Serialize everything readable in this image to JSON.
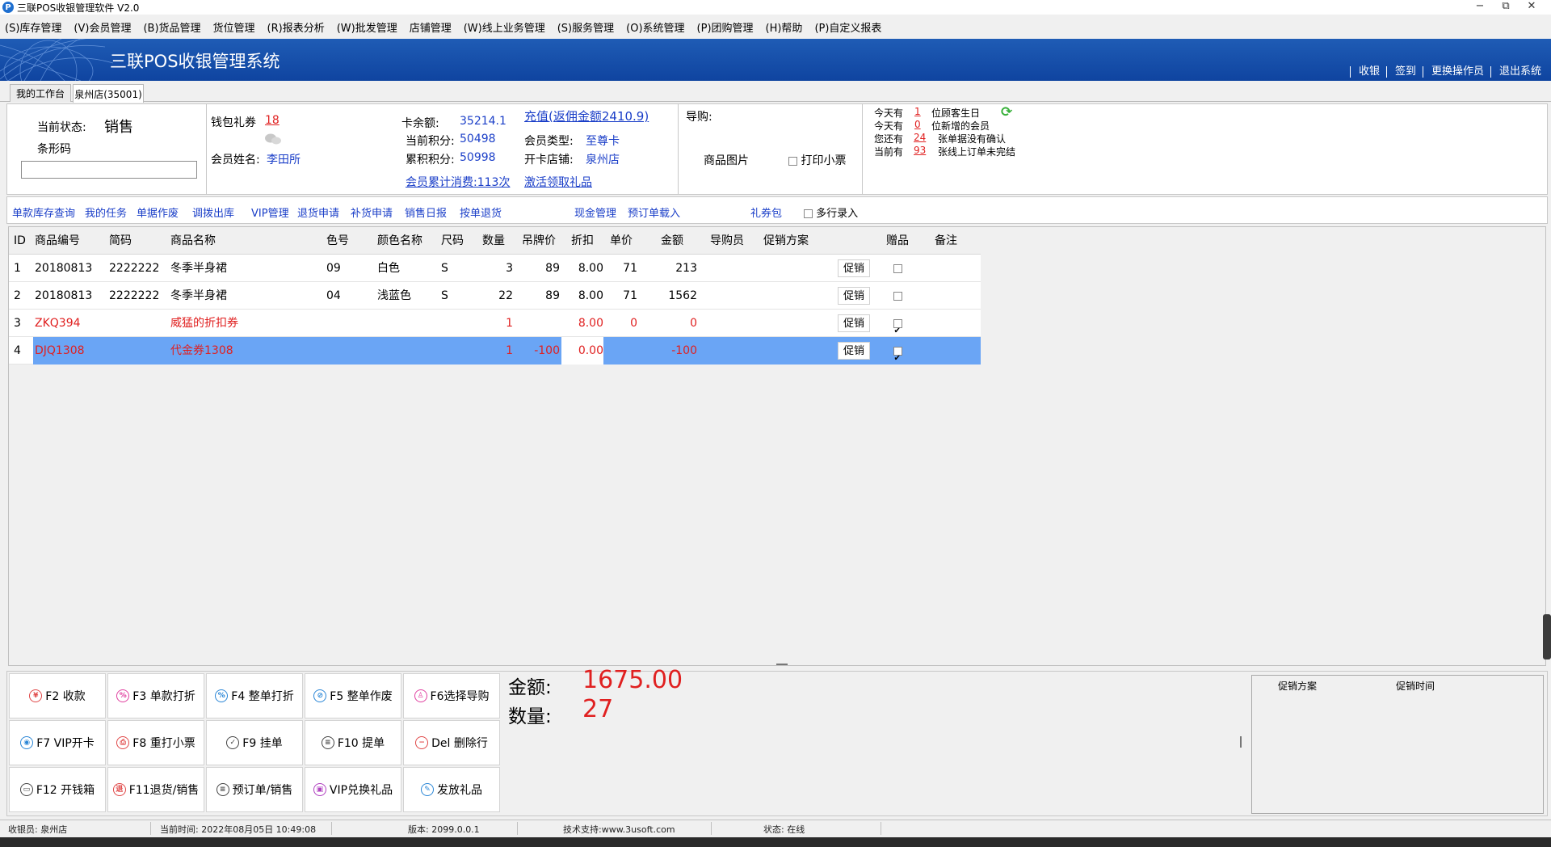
{
  "window": {
    "title": "三联POS收银管理软件 V2.0",
    "icon": "P",
    "minimize": "−",
    "restore": "⧉",
    "close": "✕"
  },
  "menu": [
    "(S)库存管理",
    "(V)会员管理",
    "(B)货品管理",
    "货位管理",
    "(R)报表分析",
    "(W)批发管理",
    "店铺管理",
    "(W)线上业务管理",
    "(S)服务管理",
    "(O)系统管理",
    "(P)团购管理",
    "(H)帮助",
    "(P)自定义报表"
  ],
  "banner": {
    "title": "三联POS收银管理系统",
    "links": [
      "收银",
      "签到",
      "更换操作员",
      "退出系统"
    ]
  },
  "tabs": [
    {
      "label": "我的工作台"
    },
    {
      "label": "泉州店(35001)"
    }
  ],
  "status_area": {
    "state_label": "当前状态:",
    "state_value": "销售",
    "barcode_label": "条形码",
    "barcode_value": ""
  },
  "member": {
    "wallet_label": "钱包礼券",
    "wallet_value": "18",
    "name_label": "会员姓名:",
    "name_value": "李田所",
    "card_balance_label": "卡余额:",
    "card_balance_value": "35214.1",
    "recharge_link": "充值(返佣金额2410.9)",
    "points_label": "当前积分:",
    "points_value": "50498",
    "member_type_label": "会员类型:",
    "member_type_value": "至尊卡",
    "total_points_label": "累积积分:",
    "total_points_value": "50998",
    "open_store_label": "开卡店铺:",
    "open_store_value": "泉州店",
    "consume_link": "会员累计消费:113次",
    "gift_link": "激活领取礼品"
  },
  "guide": {
    "label": "导购:",
    "product_image_label": "商品图片",
    "print_ticket_label": "打印小票"
  },
  "notices": [
    {
      "prefix": "今天有",
      "count": "1",
      "suffix": "位顾客生日"
    },
    {
      "prefix": "今天有",
      "count": "0",
      "suffix": "位新增的会员"
    },
    {
      "prefix": "您还有",
      "count": "24",
      "suffix": "张单据没有确认"
    },
    {
      "prefix": "当前有",
      "count": "93",
      "suffix": "张线上订单未完结"
    }
  ],
  "toolbar": [
    "单款库存查询",
    "我的任务",
    "单据作废",
    "调拨出库",
    "VIP管理",
    "退货申请",
    "补货申请",
    "销售日报",
    "按单退货",
    "现金管理",
    "预订单载入",
    "礼券包"
  ],
  "multi_entry_label": "多行录入",
  "grid": {
    "headers": [
      "ID",
      "商品编号",
      "简码",
      "商品名称",
      "色号",
      "颜色名称",
      "尺码",
      "数量",
      "吊牌价",
      "折扣",
      "单价",
      "金额",
      "导购员",
      "促销方案",
      "",
      "赠品",
      "备注"
    ],
    "promo_button_label": "促销",
    "rows": [
      {
        "id": "1",
        "code": "20180813",
        "short": "2222222",
        "name": "冬季半身裙",
        "color": "09",
        "color_name": "白色",
        "size": "S",
        "qty": "3",
        "tag_price": "89",
        "discount": "8.00",
        "unit_price": "71",
        "amount": "213",
        "guide": "",
        "promo": "",
        "gift": false,
        "note": "",
        "red": false,
        "selected": false
      },
      {
        "id": "2",
        "code": "20180813",
        "short": "2222222",
        "name": "冬季半身裙",
        "color": "04",
        "color_name": "浅蓝色",
        "size": "S",
        "qty": "22",
        "tag_price": "89",
        "discount": "8.00",
        "unit_price": "71",
        "amount": "1562",
        "guide": "",
        "promo": "",
        "gift": false,
        "note": "",
        "red": false,
        "selected": false
      },
      {
        "id": "3",
        "code": "ZKQ394",
        "short": "",
        "name": "威猛的折扣券",
        "color": "",
        "color_name": "",
        "size": "",
        "qty": "1",
        "tag_price": "",
        "discount": "8.00",
        "unit_price": "0",
        "amount": "0",
        "guide": "",
        "promo": "",
        "gift": true,
        "note": "",
        "red": true,
        "selected": false
      },
      {
        "id": "4",
        "code": "DJQ1308",
        "short": "",
        "name": "代金券1308",
        "color": "",
        "color_name": "",
        "size": "",
        "qty": "1",
        "tag_price": "-100",
        "discount": "0.00",
        "unit_price": "",
        "amount": "-100",
        "guide": "",
        "promo": "",
        "gift": true,
        "note": "",
        "red": true,
        "selected": true
      }
    ]
  },
  "function_keys": [
    {
      "label": "F2 收款",
      "icon": "yuan-icon",
      "glyph": "¥"
    },
    {
      "label": "F3 单款打折",
      "icon": "percent-icon",
      "glyph": "%"
    },
    {
      "label": "F4 整单打折",
      "icon": "percent-icon",
      "glyph": "%"
    },
    {
      "label": "F5 整单作废",
      "icon": "void-icon",
      "glyph": "⊘"
    },
    {
      "label": "F6选择导购",
      "icon": "person-icon",
      "glyph": "♙"
    },
    {
      "label": "F7 VIP开卡",
      "icon": "vip-card-icon",
      "glyph": "◉"
    },
    {
      "label": "F8 重打小票",
      "icon": "reprint-icon",
      "glyph": "⎙"
    },
    {
      "label": "F9 挂单",
      "icon": "clipboard-check-icon",
      "glyph": "✓"
    },
    {
      "label": "F10 提单",
      "icon": "document-icon",
      "glyph": "≡"
    },
    {
      "label": "Del 删除行",
      "icon": "minus-icon",
      "glyph": "−"
    },
    {
      "label": "F12 开钱箱",
      "icon": "cash-drawer-icon",
      "glyph": "▭"
    },
    {
      "label": "F11退货/销售",
      "icon": "return-icon",
      "glyph": "退"
    },
    {
      "label": "预订单/销售",
      "icon": "order-icon",
      "glyph": "≡"
    },
    {
      "label": "VIP兑换礼品",
      "icon": "gift-exchange-icon",
      "glyph": "▣"
    },
    {
      "label": "发放礼品",
      "icon": "ticket-icon",
      "glyph": "✎"
    }
  ],
  "totals": {
    "amount_label": "金额:",
    "amount_value": "1675.00",
    "qty_label": "数量:",
    "qty_value": "27"
  },
  "promo_panel": {
    "col1": "促销方案",
    "col2": "促销时间"
  },
  "statusbar": {
    "cashier": "收银员: 泉州店",
    "time": "当前时间: 2022年08月05日 10:49:08",
    "version": "版本: 2099.0.0.1",
    "support": "技术支持:www.3usoft.com",
    "state": "状态: 在线"
  }
}
